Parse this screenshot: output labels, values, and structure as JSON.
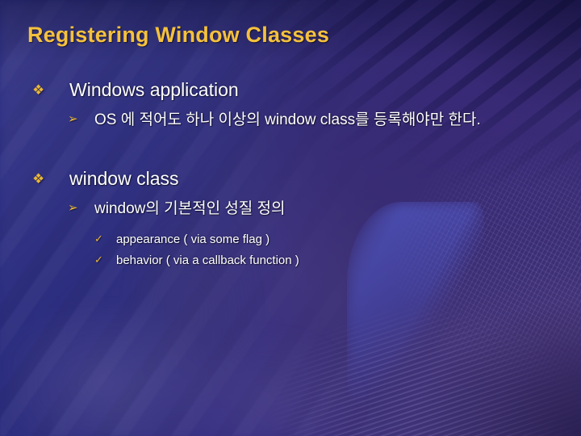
{
  "slide": {
    "title": "Registering Window Classes",
    "colors": {
      "title": "#f5c13d",
      "bullet": "#e8b63a",
      "body_text": "#ffffff",
      "background_blue": "#2b2f86",
      "background_purple": "#4a3d85"
    },
    "bullet_glyphs": {
      "level1": "❖",
      "level2": "➢",
      "level3": "✓"
    },
    "outline": [
      {
        "level": 1,
        "bullet_name": "diamond-bullet-icon",
        "text": "Windows application"
      },
      {
        "level": 2,
        "bullet_name": "arrow-bullet-icon",
        "text": "OS 에 적어도 하나 이상의 window class를 등록해야만 한다."
      },
      {
        "level": 1,
        "bullet_name": "diamond-bullet-icon",
        "text": "window class"
      },
      {
        "level": 2,
        "bullet_name": "arrow-bullet-icon",
        "text": "window의 기본적인 성질 정의"
      },
      {
        "level": 3,
        "bullet_name": "check-bullet-icon",
        "text": "appearance ( via some flag )"
      },
      {
        "level": 3,
        "bullet_name": "check-bullet-icon",
        "text": "behavior ( via a callback function )"
      }
    ]
  }
}
